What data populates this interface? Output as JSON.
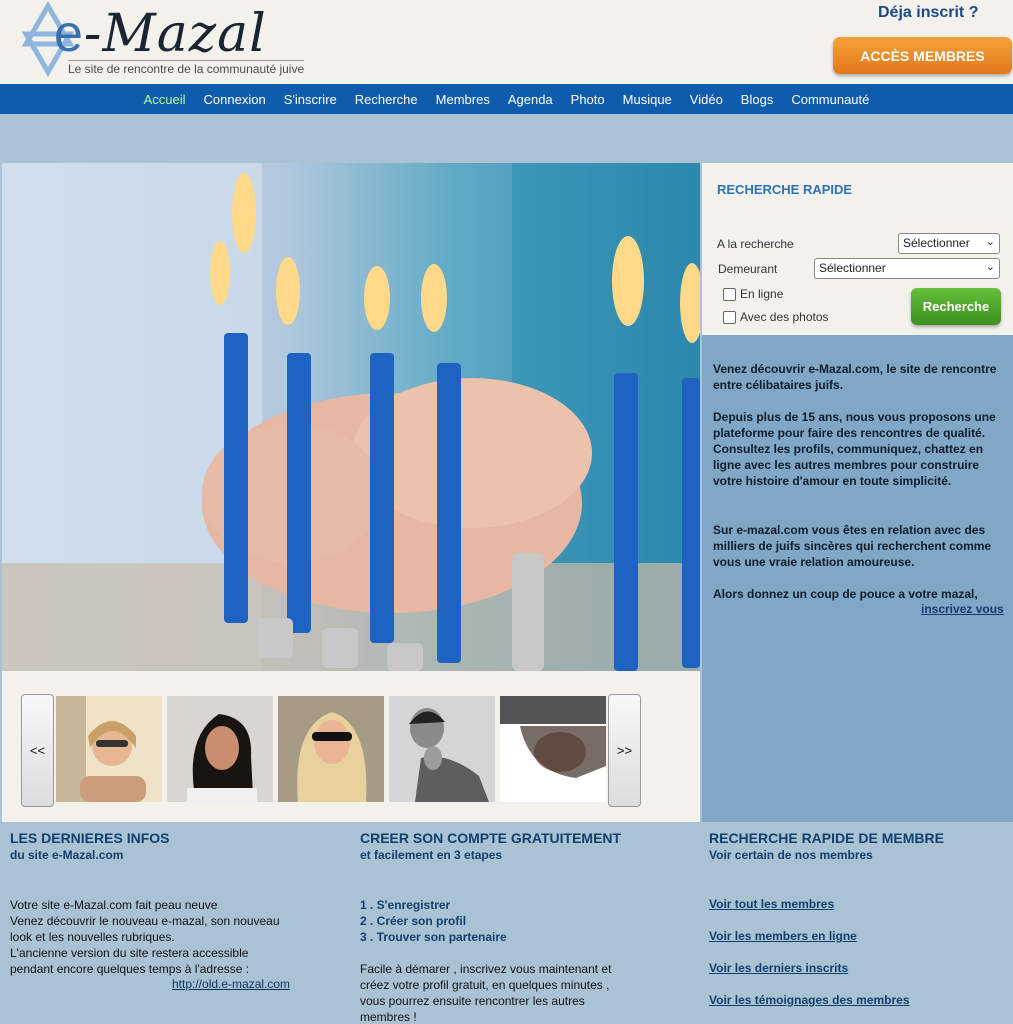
{
  "header": {
    "logo_text": "e-Mazal",
    "tagline": "Le site de rencontre de la communauté juive",
    "deja_inscrit": "Déja inscrit ?",
    "acces_membres": "ACCÈS MEMBRES"
  },
  "nav": {
    "items": [
      {
        "label": "Accueil",
        "active": true
      },
      {
        "label": "Connexion"
      },
      {
        "label": "S'inscrire"
      },
      {
        "label": "Recherche"
      },
      {
        "label": "Membres"
      },
      {
        "label": "Agenda"
      },
      {
        "label": "Photo"
      },
      {
        "label": "Musique"
      },
      {
        "label": "Vidéo"
      },
      {
        "label": "Blogs"
      },
      {
        "label": "Communauté"
      }
    ],
    "active_color": "#b6ff97"
  },
  "search": {
    "title": "RECHERCHE RAPIDE",
    "a_la_recherche_label": "A la recherche",
    "a_la_recherche_value": "Sélectionner",
    "demeurant_label": "Demeurant",
    "demeurant_value": "Sélectionner",
    "en_ligne_label": "En ligne",
    "avec_photos_label": "Avec des photos",
    "button": "Recherche"
  },
  "intro": {
    "p1": "Venez découvrir e-Mazal.com, le site de rencontre entre célibataires juifs.",
    "p2": "Depuis plus de 15 ans, nous vous proposons une plateforme pour faire des rencontres de qualité. Consultez les profils, communiquez, chattez en ligne avec les autres membres pour construire votre histoire d'amour en toute simplicité.",
    "p3": "Sur e-mazal.com vous êtes en relation avec des milliers de juifs sincères qui recherchent comme vous une vraie relation amoureuse.",
    "p4": "Alors donnez un coup de pouce a votre mazal,",
    "link": "inscrivez vous"
  },
  "carousel": {
    "prev": "<<",
    "next": ">>"
  },
  "infos": {
    "title": "LES DERNIERES INFOS",
    "subtitle": "du site e-Mazal.com",
    "text": "Votre site e-Mazal.com fait peau neuve\nVenez découvrir le nouveau e-mazal, son nouveau look et les nouvelles rubriques.\nL'ancienne version du site restera accessible pendant encore quelques temps à l'adresse :",
    "link": "http://old.e-mazal.com"
  },
  "compte": {
    "title": "CREER SON COMPTE GRATUITEMENT",
    "subtitle": "et facilement en 3 etapes",
    "step1": "1 . S'enregistrer",
    "step2": "2 . Créer son profil",
    "step3": "3 . Trouver son partenaire",
    "text": "Facile à démarer , inscrivez vous maintenant et créez votre profil gratuit, en quelques minutes , vous pourrez ensuite rencontrer les autres membres !"
  },
  "membres": {
    "title": "RECHERCHE RAPIDE DE MEMBRE",
    "subtitle": "Voir certain de nos membres",
    "links": [
      "Voir tout les membres",
      "Voir les members en ligne",
      "Voir les derniers inscrits",
      "Voir les témoignages des membres"
    ]
  },
  "colors": {
    "nav_bg": "#0f5bad",
    "page_bg": "#a9c3d4",
    "intro_bg": "#80a7c5",
    "accent_orange": "#e1781a",
    "accent_green": "#3d8f1f"
  }
}
